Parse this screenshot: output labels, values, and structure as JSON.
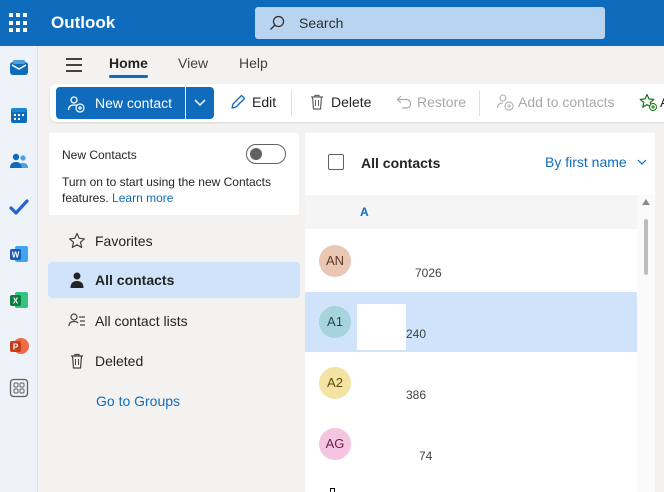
{
  "app": {
    "title": "Outlook",
    "launcher_icon": "app-launcher-icon"
  },
  "search": {
    "placeholder": "Search",
    "icon": "search-icon"
  },
  "rail": [
    {
      "name": "mail-icon",
      "color": "#0f6cbd"
    },
    {
      "name": "calendar-icon",
      "color": "#0f6cbd"
    },
    {
      "name": "people-icon",
      "color": "#0f6cbd"
    },
    {
      "name": "todo-icon",
      "color": "#2564cf"
    },
    {
      "name": "word-icon",
      "color": "#185abd"
    },
    {
      "name": "excel-icon",
      "color": "#107c41"
    },
    {
      "name": "powerpoint-icon",
      "color": "#c43e1c"
    },
    {
      "name": "more-apps-icon",
      "color": "#616161"
    }
  ],
  "tabs": [
    {
      "label": "Home",
      "active": true
    },
    {
      "label": "View",
      "active": false
    },
    {
      "label": "Help",
      "active": false
    }
  ],
  "ribbon": {
    "new_contact": "New contact",
    "edit": "Edit",
    "delete": "Delete",
    "restore": "Restore",
    "add_to_contacts": "Add to contacts",
    "add_to_favorites_partial": "A"
  },
  "new_contacts_card": {
    "title": "New Contacts",
    "toggle_on": false,
    "description": "Turn on to start using the new Contacts features.",
    "link": "Learn more"
  },
  "nav": {
    "items": [
      {
        "label": "Favorites",
        "icon": "star-icon",
        "selected": false
      },
      {
        "label": "All contacts",
        "icon": "person-icon",
        "selected": true
      },
      {
        "label": "All contact lists",
        "icon": "contact-list-icon",
        "selected": false
      },
      {
        "label": "Deleted",
        "icon": "trash-icon",
        "selected": false
      }
    ],
    "go_to_groups": "Go to Groups"
  },
  "list": {
    "title": "All contacts",
    "sort": "By first name",
    "section_letter": "A",
    "contacts": [
      {
        "initials": "AN",
        "sub": "7026",
        "avatar_bg": "#e9c7b4",
        "avatar_fg": "#5c3a28",
        "selected": false
      },
      {
        "initials": "A1",
        "sub": "240",
        "avatar_bg": "#a6d3dc",
        "avatar_fg": "#1d4d56",
        "selected": true
      },
      {
        "initials": "A2",
        "sub": "386",
        "avatar_bg": "#f4e3a3",
        "avatar_fg": "#5c4a08",
        "selected": false
      },
      {
        "initials": "AG",
        "sub": "74",
        "avatar_bg": "#f5c4e0",
        "avatar_fg": "#6b1f4c",
        "selected": false
      }
    ]
  }
}
